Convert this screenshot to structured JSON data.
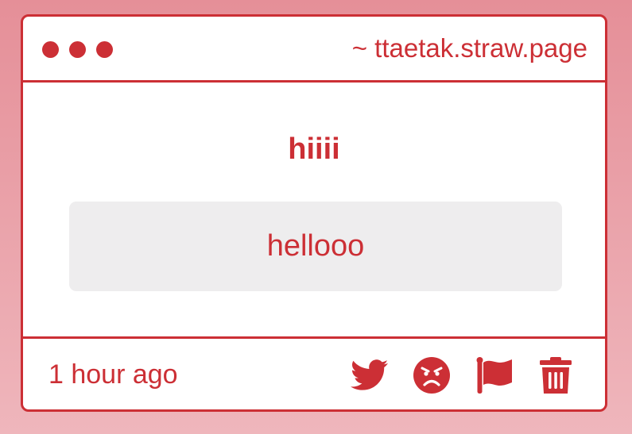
{
  "window": {
    "url": "~ ttaetak.straw.page"
  },
  "post": {
    "question": "hiiii",
    "answer": "hellooo",
    "timestamp": "1 hour ago"
  },
  "actions": [
    {
      "icon": "twitter-icon"
    },
    {
      "icon": "angry-face-icon"
    },
    {
      "icon": "flag-icon"
    },
    {
      "icon": "trash-icon"
    }
  ],
  "colors": {
    "accent": "#cc2f35",
    "answer_background": "#eeedee",
    "card_background": "#ffffff",
    "page_background_top": "#e58f98",
    "page_background_bottom": "#efb6bc"
  }
}
